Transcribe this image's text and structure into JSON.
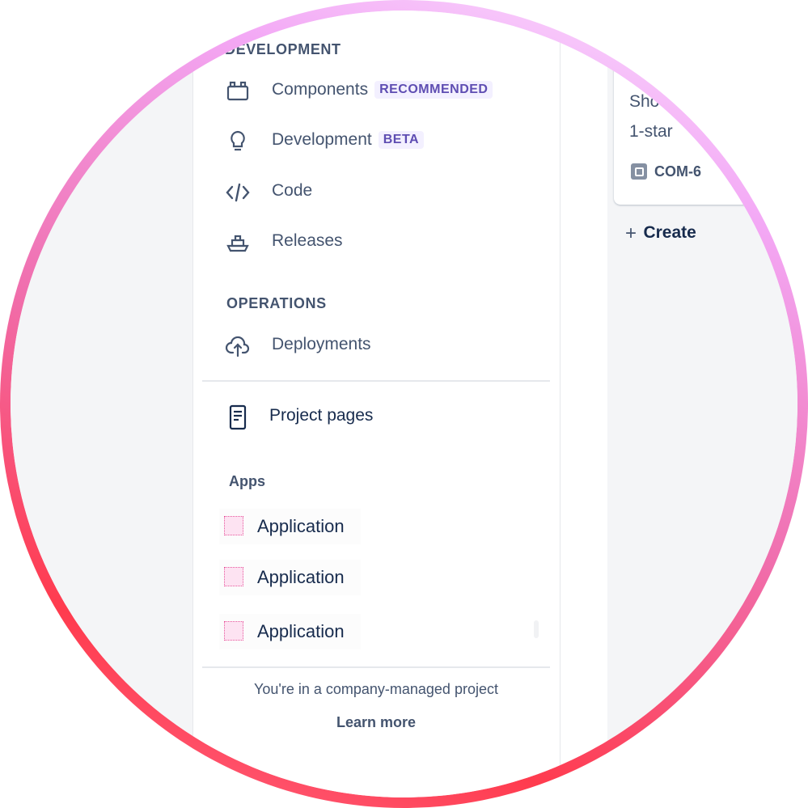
{
  "sidebar": {
    "development_header": "DEVELOPMENT",
    "development_items": [
      {
        "label": "Components",
        "badge": "RECOMMENDED",
        "icon": "components-icon"
      },
      {
        "label": "Development",
        "badge": "BETA",
        "icon": "lightbulb-icon"
      },
      {
        "label": "Code",
        "icon": "code-icon"
      },
      {
        "label": "Releases",
        "icon": "ship-icon"
      }
    ],
    "operations_header": "OPERATIONS",
    "operations_items": [
      {
        "label": "Deployments",
        "icon": "cloud-upload-icon"
      }
    ],
    "project_pages": {
      "label": "Project pages",
      "icon": "document-icon"
    },
    "apps_header": "Apps",
    "apps": [
      {
        "label": "Application"
      },
      {
        "label": "Application"
      },
      {
        "label": "Application"
      }
    ],
    "footer": {
      "message": "You're in a company-managed project",
      "link": "Learn more"
    }
  },
  "board": {
    "card": {
      "line1": "Sho",
      "line2": "1-star",
      "key": "COM-6"
    },
    "create_label": "Create"
  },
  "colors": {
    "ring_gradient": [
      "#fbe3ff",
      "#f3a8f5",
      "#f06fae",
      "#ff3b4e"
    ],
    "text_subtle": "#44546f",
    "text_strong": "#172b4d",
    "lozenge_bg": "#f3f0ff",
    "lozenge_text": "#5e4db2"
  }
}
